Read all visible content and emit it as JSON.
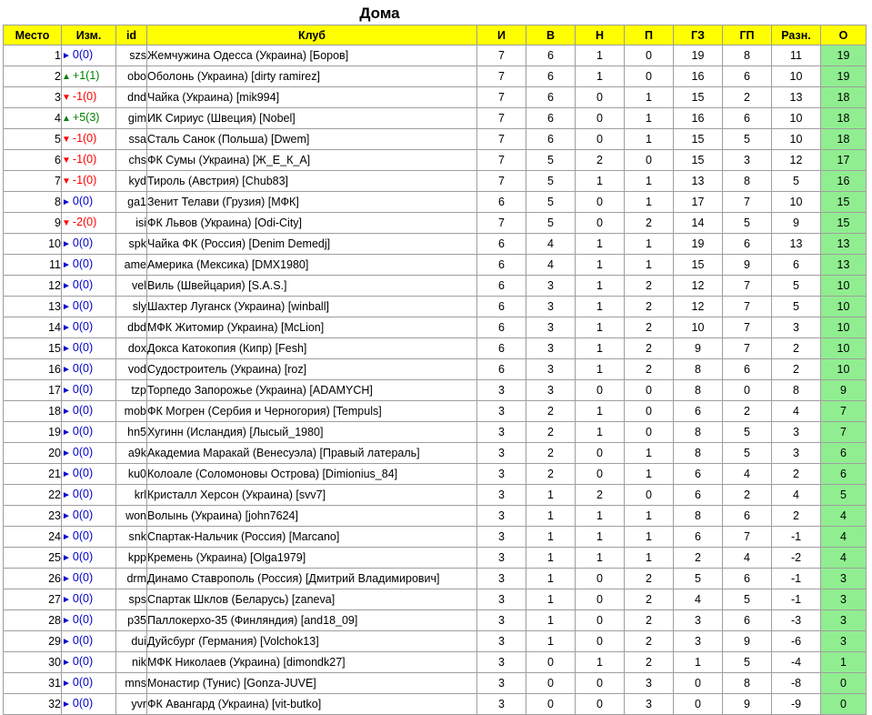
{
  "title": "Дома",
  "headers": {
    "place": "Место",
    "change": "Изм.",
    "id": "id",
    "club": "Клуб",
    "games": "И",
    "wins": "В",
    "draws": "Н",
    "losses": "П",
    "goals_for": "ГЗ",
    "goals_against": "ГП",
    "diff": "Разн.",
    "points": "О"
  },
  "colors": {
    "header_bg": "#ffff00",
    "points_bg": "#90ee90",
    "up": "#008000",
    "down": "#ff0000",
    "same": "#0000cc"
  },
  "rows": [
    {
      "place": "1",
      "dir": "same",
      "change": "0(0)",
      "id": "szs",
      "club": "Жемчужина Одесса (Украина) [Боров]",
      "games": "7",
      "wins": "6",
      "draws": "1",
      "losses": "0",
      "gf": "19",
      "ga": "8",
      "diff": "11",
      "pts": "19"
    },
    {
      "place": "2",
      "dir": "up",
      "change": "+1(1)",
      "id": "obo",
      "club": "Оболонь (Украина) [dirty ramirez]",
      "games": "7",
      "wins": "6",
      "draws": "1",
      "losses": "0",
      "gf": "16",
      "ga": "6",
      "diff": "10",
      "pts": "19"
    },
    {
      "place": "3",
      "dir": "down",
      "change": "-1(0)",
      "id": "dnd",
      "club": "Чайка (Украина) [mik994]",
      "games": "7",
      "wins": "6",
      "draws": "0",
      "losses": "1",
      "gf": "15",
      "ga": "2",
      "diff": "13",
      "pts": "18"
    },
    {
      "place": "4",
      "dir": "up",
      "change": "+5(3)",
      "id": "gim",
      "club": "ИК Сириус (Швеция) [Nobel]",
      "games": "7",
      "wins": "6",
      "draws": "0",
      "losses": "1",
      "gf": "16",
      "ga": "6",
      "diff": "10",
      "pts": "18"
    },
    {
      "place": "5",
      "dir": "down",
      "change": "-1(0)",
      "id": "ssa",
      "club": "Сталь Санок (Польша) [Dwem]",
      "games": "7",
      "wins": "6",
      "draws": "0",
      "losses": "1",
      "gf": "15",
      "ga": "5",
      "diff": "10",
      "pts": "18"
    },
    {
      "place": "6",
      "dir": "down",
      "change": "-1(0)",
      "id": "chs",
      "club": "ФК Сумы (Украина) [Ж_Е_К_А]",
      "games": "7",
      "wins": "5",
      "draws": "2",
      "losses": "0",
      "gf": "15",
      "ga": "3",
      "diff": "12",
      "pts": "17"
    },
    {
      "place": "7",
      "dir": "down",
      "change": "-1(0)",
      "id": "kyd",
      "club": "Тироль (Австрия) [Chub83]",
      "games": "7",
      "wins": "5",
      "draws": "1",
      "losses": "1",
      "gf": "13",
      "ga": "8",
      "diff": "5",
      "pts": "16"
    },
    {
      "place": "8",
      "dir": "same",
      "change": "0(0)",
      "id": "ga1",
      "club": "Зенит Телави (Грузия) [МФК]",
      "games": "6",
      "wins": "5",
      "draws": "0",
      "losses": "1",
      "gf": "17",
      "ga": "7",
      "diff": "10",
      "pts": "15"
    },
    {
      "place": "9",
      "dir": "down",
      "change": "-2(0)",
      "id": "isi",
      "club": "ФК Львов (Украина) [Odi-City]",
      "games": "7",
      "wins": "5",
      "draws": "0",
      "losses": "2",
      "gf": "14",
      "ga": "5",
      "diff": "9",
      "pts": "15"
    },
    {
      "place": "10",
      "dir": "same",
      "change": "0(0)",
      "id": "spk",
      "club": "Чайка ФК (Россия) [Denim Demedj]",
      "games": "6",
      "wins": "4",
      "draws": "1",
      "losses": "1",
      "gf": "19",
      "ga": "6",
      "diff": "13",
      "pts": "13"
    },
    {
      "place": "11",
      "dir": "same",
      "change": "0(0)",
      "id": "ame",
      "club": "Америка (Мексика) [DMX1980]",
      "games": "6",
      "wins": "4",
      "draws": "1",
      "losses": "1",
      "gf": "15",
      "ga": "9",
      "diff": "6",
      "pts": "13"
    },
    {
      "place": "12",
      "dir": "same",
      "change": "0(0)",
      "id": "vel",
      "club": "Виль (Швейцария) [S.A.S.]",
      "games": "6",
      "wins": "3",
      "draws": "1",
      "losses": "2",
      "gf": "12",
      "ga": "7",
      "diff": "5",
      "pts": "10"
    },
    {
      "place": "13",
      "dir": "same",
      "change": "0(0)",
      "id": "sly",
      "club": "Шахтер Луганск (Украина) [winball]",
      "games": "6",
      "wins": "3",
      "draws": "1",
      "losses": "2",
      "gf": "12",
      "ga": "7",
      "diff": "5",
      "pts": "10"
    },
    {
      "place": "14",
      "dir": "same",
      "change": "0(0)",
      "id": "dbd",
      "club": "МФК Житомир (Украина) [McLion]",
      "games": "6",
      "wins": "3",
      "draws": "1",
      "losses": "2",
      "gf": "10",
      "ga": "7",
      "diff": "3",
      "pts": "10"
    },
    {
      "place": "15",
      "dir": "same",
      "change": "0(0)",
      "id": "dox",
      "club": "Докса Катокопия (Кипр) [Fesh]",
      "games": "6",
      "wins": "3",
      "draws": "1",
      "losses": "2",
      "gf": "9",
      "ga": "7",
      "diff": "2",
      "pts": "10"
    },
    {
      "place": "16",
      "dir": "same",
      "change": "0(0)",
      "id": "vod",
      "club": "Судостроитель (Украина) [roz]",
      "games": "6",
      "wins": "3",
      "draws": "1",
      "losses": "2",
      "gf": "8",
      "ga": "6",
      "diff": "2",
      "pts": "10"
    },
    {
      "place": "17",
      "dir": "same",
      "change": "0(0)",
      "id": "tzp",
      "club": "Торпедо Запорожье (Украина) [ADAMYCH]",
      "games": "3",
      "wins": "3",
      "draws": "0",
      "losses": "0",
      "gf": "8",
      "ga": "0",
      "diff": "8",
      "pts": "9"
    },
    {
      "place": "18",
      "dir": "same",
      "change": "0(0)",
      "id": "mob",
      "club": "ФК Могрен (Сербия и Черногория) [Tempuls]",
      "games": "3",
      "wins": "2",
      "draws": "1",
      "losses": "0",
      "gf": "6",
      "ga": "2",
      "diff": "4",
      "pts": "7"
    },
    {
      "place": "19",
      "dir": "same",
      "change": "0(0)",
      "id": "hn5",
      "club": "Хугинн (Исландия) [Лысый_1980]",
      "games": "3",
      "wins": "2",
      "draws": "1",
      "losses": "0",
      "gf": "8",
      "ga": "5",
      "diff": "3",
      "pts": "7"
    },
    {
      "place": "20",
      "dir": "same",
      "change": "0(0)",
      "id": "a9k",
      "club": "Академиа Маракай (Венесуэла) [Правый латераль]",
      "games": "3",
      "wins": "2",
      "draws": "0",
      "losses": "1",
      "gf": "8",
      "ga": "5",
      "diff": "3",
      "pts": "6"
    },
    {
      "place": "21",
      "dir": "same",
      "change": "0(0)",
      "id": "ku0",
      "club": "Колоале (Соломоновы Острова) [Dimionius_84]",
      "games": "3",
      "wins": "2",
      "draws": "0",
      "losses": "1",
      "gf": "6",
      "ga": "4",
      "diff": "2",
      "pts": "6"
    },
    {
      "place": "22",
      "dir": "same",
      "change": "0(0)",
      "id": "krl",
      "club": "Кристалл Херсон (Украина) [svv7]",
      "games": "3",
      "wins": "1",
      "draws": "2",
      "losses": "0",
      "gf": "6",
      "ga": "2",
      "diff": "4",
      "pts": "5"
    },
    {
      "place": "23",
      "dir": "same",
      "change": "0(0)",
      "id": "won",
      "club": "Волынь (Украина) [john7624]",
      "games": "3",
      "wins": "1",
      "draws": "1",
      "losses": "1",
      "gf": "8",
      "ga": "6",
      "diff": "2",
      "pts": "4"
    },
    {
      "place": "24",
      "dir": "same",
      "change": "0(0)",
      "id": "snk",
      "club": "Спартак-Нальчик (Россия) [Marcano]",
      "games": "3",
      "wins": "1",
      "draws": "1",
      "losses": "1",
      "gf": "6",
      "ga": "7",
      "diff": "-1",
      "pts": "4"
    },
    {
      "place": "25",
      "dir": "same",
      "change": "0(0)",
      "id": "kpp",
      "club": "Кремень (Украина) [Olga1979]",
      "games": "3",
      "wins": "1",
      "draws": "1",
      "losses": "1",
      "gf": "2",
      "ga": "4",
      "diff": "-2",
      "pts": "4"
    },
    {
      "place": "26",
      "dir": "same",
      "change": "0(0)",
      "id": "drm",
      "club": "Динамо Ставрополь (Россия) [Дмитрий Владимирович]",
      "games": "3",
      "wins": "1",
      "draws": "0",
      "losses": "2",
      "gf": "5",
      "ga": "6",
      "diff": "-1",
      "pts": "3"
    },
    {
      "place": "27",
      "dir": "same",
      "change": "0(0)",
      "id": "sps",
      "club": "Спартак Шклов (Беларусь) [zaneva]",
      "games": "3",
      "wins": "1",
      "draws": "0",
      "losses": "2",
      "gf": "4",
      "ga": "5",
      "diff": "-1",
      "pts": "3"
    },
    {
      "place": "28",
      "dir": "same",
      "change": "0(0)",
      "id": "p35",
      "club": "Паллокерхо-35 (Финляндия) [and18_09]",
      "games": "3",
      "wins": "1",
      "draws": "0",
      "losses": "2",
      "gf": "3",
      "ga": "6",
      "diff": "-3",
      "pts": "3"
    },
    {
      "place": "29",
      "dir": "same",
      "change": "0(0)",
      "id": "dui",
      "club": "Дуйсбург (Германия) [Volchok13]",
      "games": "3",
      "wins": "1",
      "draws": "0",
      "losses": "2",
      "gf": "3",
      "ga": "9",
      "diff": "-6",
      "pts": "3"
    },
    {
      "place": "30",
      "dir": "same",
      "change": "0(0)",
      "id": "nik",
      "club": "МФК Николаев (Украина) [dimondk27]",
      "games": "3",
      "wins": "0",
      "draws": "1",
      "losses": "2",
      "gf": "1",
      "ga": "5",
      "diff": "-4",
      "pts": "1"
    },
    {
      "place": "31",
      "dir": "same",
      "change": "0(0)",
      "id": "mns",
      "club": "Монастир (Тунис) [Gonza-JUVE]",
      "games": "3",
      "wins": "0",
      "draws": "0",
      "losses": "3",
      "gf": "0",
      "ga": "8",
      "diff": "-8",
      "pts": "0"
    },
    {
      "place": "32",
      "dir": "same",
      "change": "0(0)",
      "id": "yvr",
      "club": "ФК Авангард (Украина) [vit-butko]",
      "games": "3",
      "wins": "0",
      "draws": "0",
      "losses": "3",
      "gf": "0",
      "ga": "9",
      "diff": "-9",
      "pts": "0"
    }
  ]
}
